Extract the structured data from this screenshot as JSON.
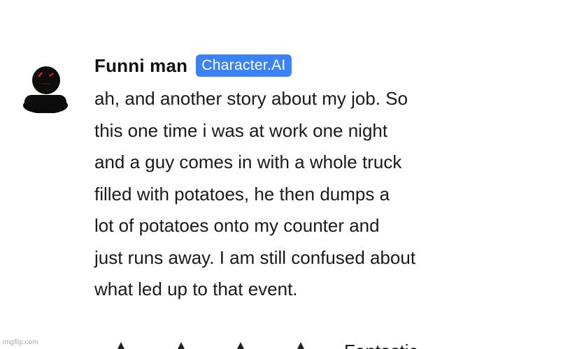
{
  "character": {
    "name": "Funni man",
    "badge": "Character.AI",
    "avatar_icon": "dark-figure-avatar-icon"
  },
  "message": {
    "lines": [
      "ah, and another story about my job. So",
      "this one time i was at work one night",
      "and a guy comes in with a whole truck",
      "filled with potatoes, he then dumps a",
      "lot of potatoes onto my counter and",
      "just runs away. I am still confused about",
      "what led up to that event."
    ]
  },
  "rating": {
    "label": "Fantastic",
    "star_icon": "star-icon"
  },
  "watermark": "imgflip.com",
  "colors": {
    "badge_background": "#3b82f6",
    "text": "#1a1a1a",
    "avatar_eyes": "#d61b1b"
  }
}
